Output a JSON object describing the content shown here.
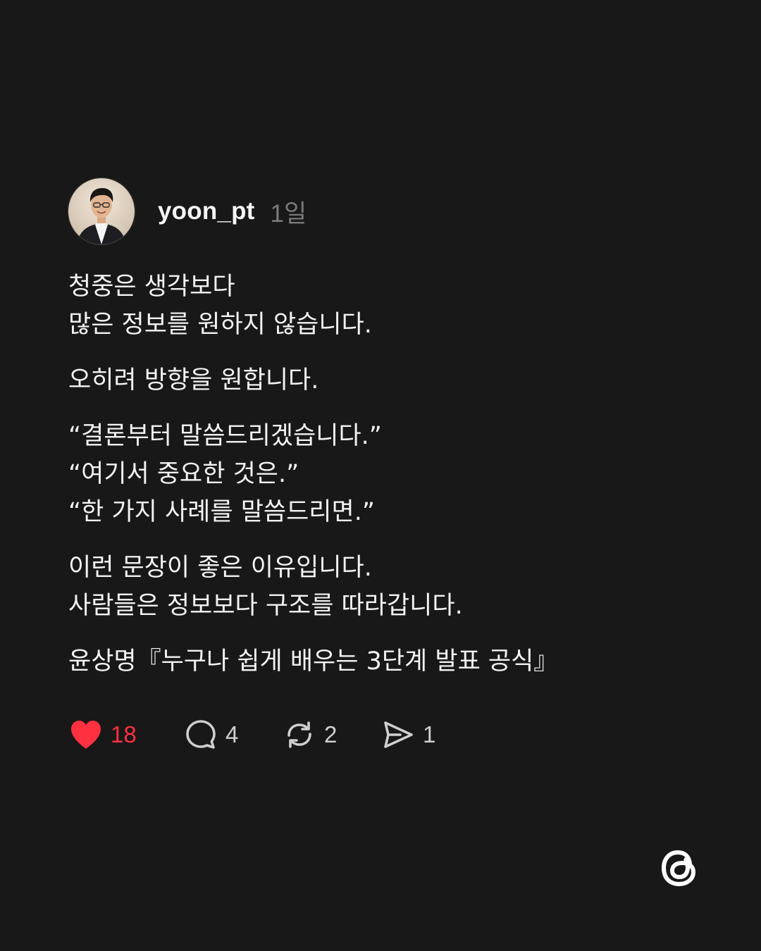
{
  "post": {
    "username": "yoon_pt",
    "time": "1일",
    "paragraphs": [
      [
        "청중은 생각보다",
        "많은 정보를 원하지 않습니다."
      ],
      [
        "오히려 방향을 원합니다."
      ],
      [
        "“결론부터 말씀드리겠습니다.”",
        "“여기서 중요한 것은.”",
        "“한 가지 사례를 말씀드리면.”"
      ],
      [
        "이런 문장이 좋은 이유입니다.",
        "사람들은 정보보다 구조를 따라갑니다."
      ],
      [
        "윤상명『누구나 쉽게 배우는 3단계 발표 공식』"
      ]
    ]
  },
  "actions": {
    "likes": "18",
    "comments": "4",
    "reposts": "2",
    "shares": "1"
  },
  "icons": {
    "like": "heart-icon",
    "comment": "comment-bubble-icon",
    "repost": "repost-icon",
    "share": "send-icon",
    "brand": "threads-logo"
  },
  "colors": {
    "background": "#181818",
    "like_active": "#ff3040",
    "text": "#f3f3f3",
    "muted": "#7a7a7a"
  }
}
